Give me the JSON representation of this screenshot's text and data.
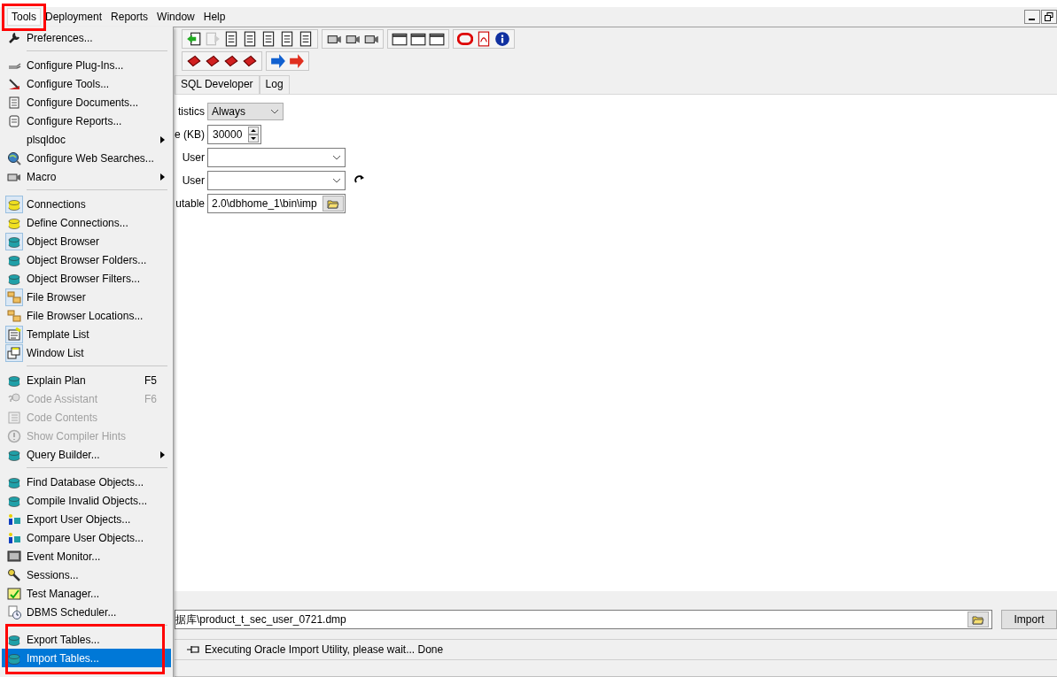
{
  "menubar": [
    {
      "label": "Tools",
      "selected": true
    },
    {
      "label": "Deployment",
      "selected": false
    },
    {
      "label": "Reports",
      "selected": false
    },
    {
      "label": "Window",
      "selected": false
    },
    {
      "label": "Help",
      "selected": false
    }
  ],
  "tools_menu": {
    "items": [
      {
        "kind": "item",
        "label": "Preferences...",
        "checked": false,
        "disabled": false,
        "submenu": false,
        "selected": false
      },
      {
        "kind": "separator"
      },
      {
        "kind": "item",
        "label": "Configure Plug-Ins...",
        "checked": false,
        "disabled": false,
        "submenu": false,
        "selected": false
      },
      {
        "kind": "item",
        "label": "Configure Tools...",
        "checked": false,
        "disabled": false,
        "submenu": false,
        "selected": false
      },
      {
        "kind": "item",
        "label": "Configure Documents...",
        "checked": false,
        "disabled": false,
        "submenu": false,
        "selected": false
      },
      {
        "kind": "item",
        "label": "Configure Reports...",
        "checked": false,
        "disabled": false,
        "submenu": false,
        "selected": false
      },
      {
        "kind": "item",
        "label": "plsqldoc",
        "checked": false,
        "disabled": false,
        "submenu": true,
        "selected": false
      },
      {
        "kind": "item",
        "label": "Configure Web Searches...",
        "checked": false,
        "disabled": false,
        "submenu": false,
        "selected": false
      },
      {
        "kind": "item",
        "label": "Macro",
        "checked": false,
        "disabled": false,
        "submenu": true,
        "selected": false
      },
      {
        "kind": "separator"
      },
      {
        "kind": "item",
        "label": "Connections",
        "checked": true,
        "disabled": false,
        "submenu": false,
        "selected": false
      },
      {
        "kind": "item",
        "label": "Define Connections...",
        "checked": false,
        "disabled": false,
        "submenu": false,
        "selected": false
      },
      {
        "kind": "item",
        "label": "Object Browser",
        "checked": true,
        "disabled": false,
        "submenu": false,
        "selected": false
      },
      {
        "kind": "item",
        "label": "Object Browser Folders...",
        "checked": false,
        "disabled": false,
        "submenu": false,
        "selected": false
      },
      {
        "kind": "item",
        "label": "Object Browser Filters...",
        "checked": false,
        "disabled": false,
        "submenu": false,
        "selected": false
      },
      {
        "kind": "item",
        "label": "File Browser",
        "checked": true,
        "disabled": false,
        "submenu": false,
        "selected": false
      },
      {
        "kind": "item",
        "label": "File Browser Locations...",
        "checked": false,
        "disabled": false,
        "submenu": false,
        "selected": false
      },
      {
        "kind": "item",
        "label": "Template List",
        "checked": true,
        "disabled": false,
        "submenu": false,
        "selected": false
      },
      {
        "kind": "item",
        "label": "Window List",
        "checked": true,
        "disabled": false,
        "submenu": false,
        "selected": false
      },
      {
        "kind": "separator"
      },
      {
        "kind": "item",
        "label": "Explain Plan",
        "shortcut": "F5",
        "checked": false,
        "disabled": false,
        "submenu": false,
        "selected": false
      },
      {
        "kind": "item",
        "label": "Code Assistant",
        "shortcut": "F6",
        "checked": false,
        "disabled": true,
        "submenu": false,
        "selected": false
      },
      {
        "kind": "item",
        "label": "Code Contents",
        "checked": false,
        "disabled": true,
        "submenu": false,
        "selected": false
      },
      {
        "kind": "item",
        "label": "Show Compiler Hints",
        "checked": false,
        "disabled": true,
        "submenu": false,
        "selected": false
      },
      {
        "kind": "item",
        "label": "Query Builder...",
        "checked": false,
        "disabled": false,
        "submenu": true,
        "selected": false
      },
      {
        "kind": "separator"
      },
      {
        "kind": "item",
        "label": "Find Database Objects...",
        "checked": false,
        "disabled": false,
        "submenu": false,
        "selected": false
      },
      {
        "kind": "item",
        "label": "Compile Invalid Objects...",
        "checked": false,
        "disabled": false,
        "submenu": false,
        "selected": false
      },
      {
        "kind": "item",
        "label": "Export User Objects...",
        "checked": false,
        "disabled": false,
        "submenu": false,
        "selected": false
      },
      {
        "kind": "item",
        "label": "Compare User Objects...",
        "checked": false,
        "disabled": false,
        "submenu": false,
        "selected": false
      },
      {
        "kind": "item",
        "label": "Event Monitor...",
        "checked": false,
        "disabled": false,
        "submenu": false,
        "selected": false
      },
      {
        "kind": "item",
        "label": "Sessions...",
        "checked": false,
        "disabled": false,
        "submenu": false,
        "selected": false
      },
      {
        "kind": "item",
        "label": "Test Manager...",
        "checked": false,
        "disabled": false,
        "submenu": false,
        "selected": false
      },
      {
        "kind": "item",
        "label": "DBMS Scheduler...",
        "checked": false,
        "disabled": false,
        "submenu": false,
        "selected": false
      },
      {
        "kind": "separator"
      },
      {
        "kind": "item",
        "label": "Export Tables...",
        "checked": false,
        "disabled": false,
        "submenu": false,
        "selected": false
      },
      {
        "kind": "item",
        "label": "Import Tables...",
        "checked": false,
        "disabled": false,
        "submenu": false,
        "selected": true
      }
    ]
  },
  "tabs": [
    {
      "label": "SQL Developer",
      "selected": false
    },
    {
      "label": "Log",
      "selected": false
    }
  ],
  "form": {
    "rows": [
      {
        "kind": "select",
        "label": "tistics",
        "value": "Always"
      },
      {
        "kind": "spin",
        "label": "e (KB)",
        "value": "30000"
      },
      {
        "kind": "combo",
        "label": "User"
      },
      {
        "kind": "combo_refresh",
        "label": "User"
      },
      {
        "kind": "file",
        "label": "utable",
        "value": "2.0\\dbhome_1\\bin\\imp"
      }
    ]
  },
  "import_file": {
    "value": "据库\\product_t_sec_user_0721.dmp",
    "button": "Import"
  },
  "status": {
    "message": "Executing Oracle Import Utility, please wait... Done"
  }
}
